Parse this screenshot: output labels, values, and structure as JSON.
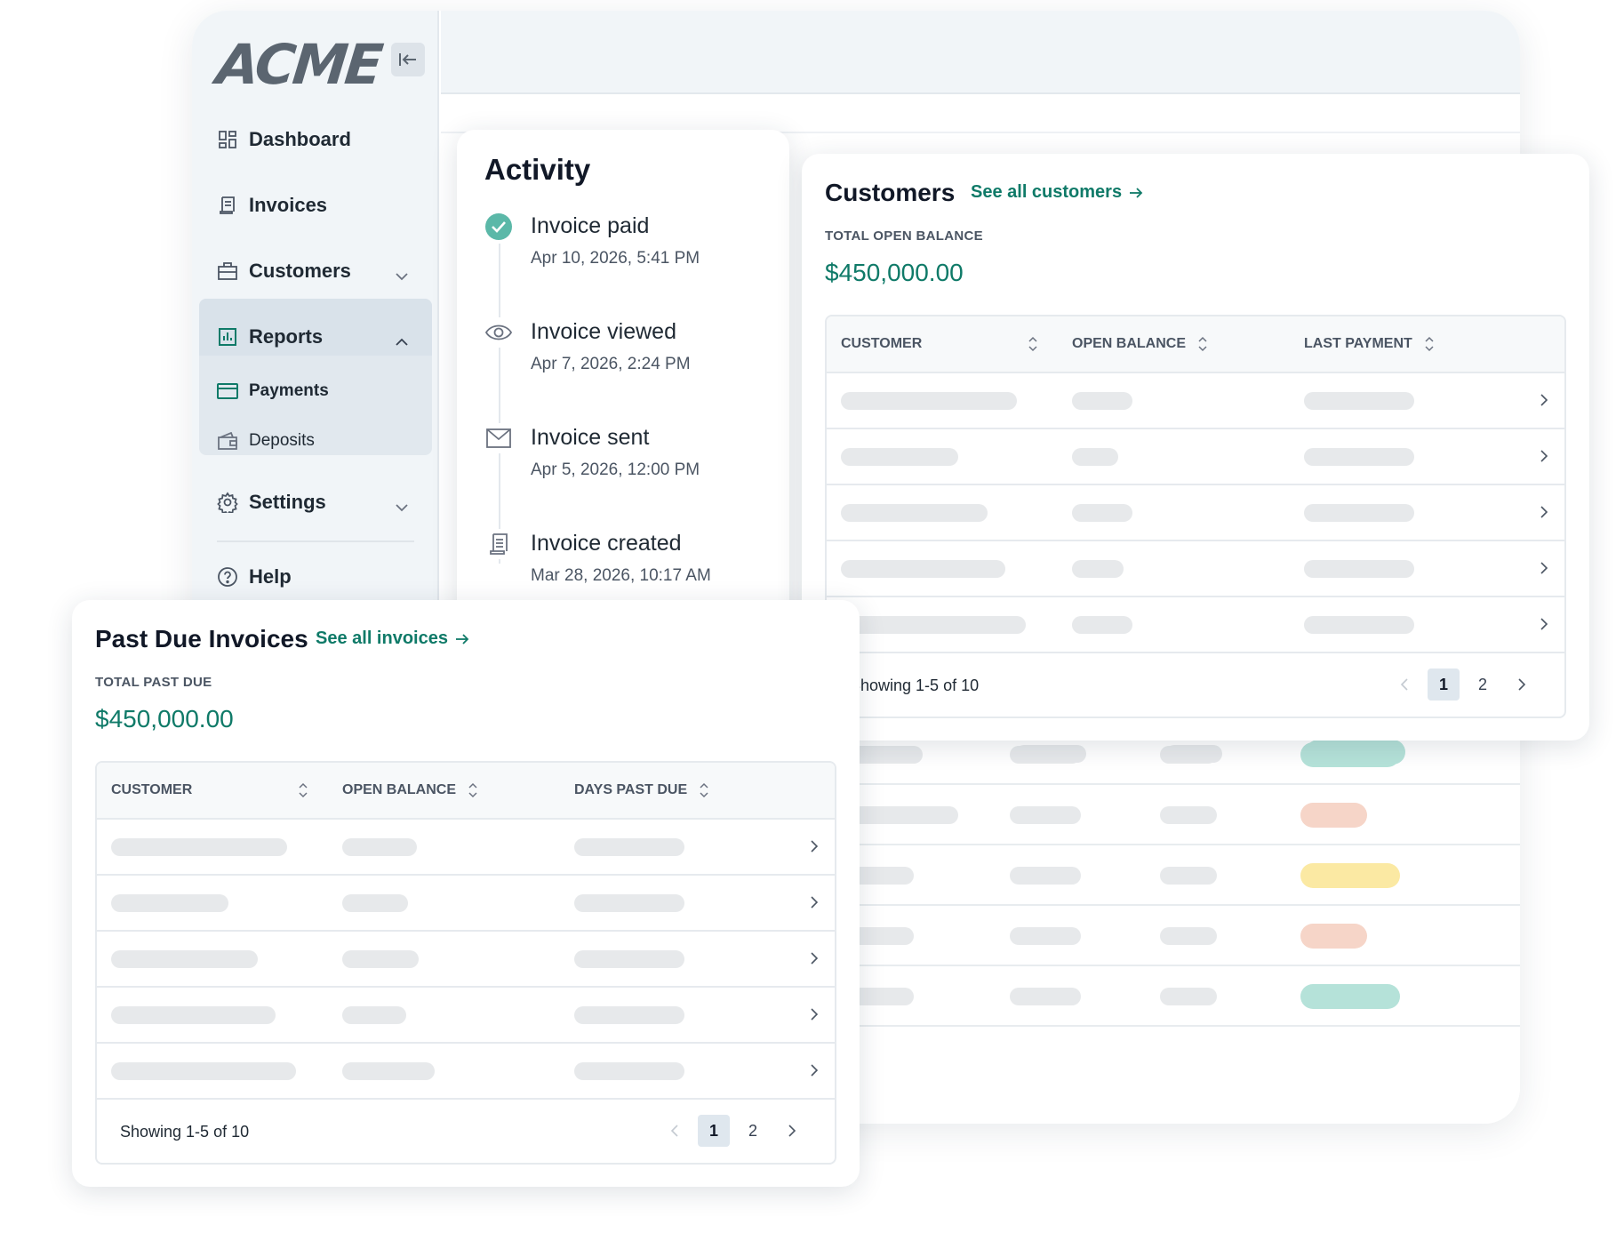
{
  "app": {
    "logo": "ACME",
    "nav": {
      "dashboard": "Dashboard",
      "invoices": "Invoices",
      "customers": "Customers",
      "reports": "Reports",
      "payments": "Payments",
      "deposits": "Deposits",
      "settings": "Settings",
      "help": "Help"
    }
  },
  "activity": {
    "title": "Activity",
    "items": [
      {
        "title": "Invoice paid",
        "date": "Apr 10, 2026, 5:41 PM",
        "icon": "check-circle-icon"
      },
      {
        "title": "Invoice viewed",
        "date": "Apr 7, 2026, 2:24 PM",
        "icon": "eye-icon"
      },
      {
        "title": "Invoice sent",
        "date": "Apr 5, 2026, 12:00 PM",
        "icon": "envelope-icon"
      },
      {
        "title": "Invoice created",
        "date": "Mar 28, 2026, 10:17 AM",
        "icon": "document-icon"
      }
    ]
  },
  "customers_card": {
    "title": "Customers",
    "link": "See all customers",
    "kpi_label": "TOTAL OPEN BALANCE",
    "kpi_value": "$450,000.00",
    "columns": [
      "CUSTOMER",
      "OPEN BALANCE",
      "LAST PAYMENT"
    ],
    "showing": "Showing 1-5 of 10",
    "pages": [
      "1",
      "2"
    ]
  },
  "past_due_card": {
    "title": "Past Due Invoices",
    "link": "See all invoices",
    "kpi_label": "TOTAL PAST DUE",
    "kpi_value": "$450,000.00",
    "columns": [
      "CUSTOMER",
      "OPEN BALANCE",
      "DAYS PAST DUE"
    ],
    "showing": "Showing 1-5 of 10",
    "pages": [
      "1",
      "2"
    ]
  },
  "colors": {
    "accent": "#0f7a68",
    "status_green": "#b5e2d9",
    "status_red": "#f6d5c8",
    "status_yellow": "#fbe9a3",
    "skeleton": "#e7e9eb"
  }
}
